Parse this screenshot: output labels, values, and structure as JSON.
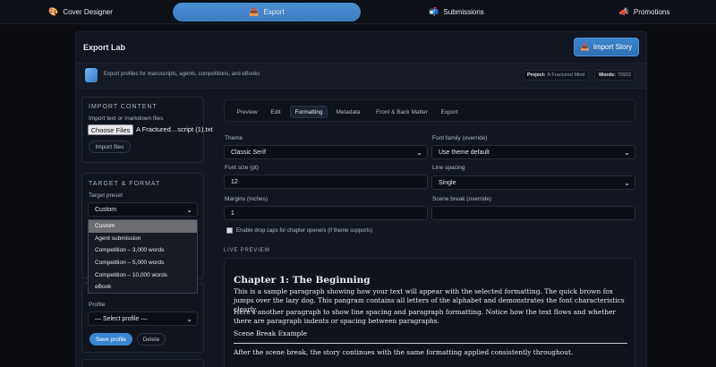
{
  "nav": {
    "tabs": [
      {
        "label": "Cover Designer",
        "icon": "palette-icon"
      },
      {
        "label": "Export",
        "icon": "outbox-icon"
      },
      {
        "label": "Submissions",
        "icon": "mailbox-icon"
      },
      {
        "label": "Promotions",
        "icon": "megaphone-icon"
      }
    ],
    "active": "Export"
  },
  "header": {
    "title": "Export Lab",
    "import_story_label": "Import Story",
    "subtitle": "Export profiles for manuscripts, agents, competitions, and eBooks",
    "project_label": "Project:",
    "project_value": "A Fractured Mind",
    "words_label": "Words:",
    "words_value": "79932"
  },
  "import_content": {
    "heading": "IMPORT CONTENT",
    "hint": "Import text or markdown files",
    "choose_files_label": "Choose Files",
    "file_name": "A Fractured…script (1).txt",
    "import_button": "Import files"
  },
  "target_format": {
    "heading": "TARGET & FORMAT",
    "preset_label": "Target preset",
    "preset_value": "Custom",
    "options": [
      "Custom",
      "Agent submission",
      "Competition – 3,000 words",
      "Competition – 5,000 words",
      "Competition – 10,000 words",
      "eBook"
    ],
    "selected_option": "Custom"
  },
  "profile": {
    "label": "Profile",
    "value": "— Select profile —",
    "save_label": "Save profile",
    "delete_label": "Delete"
  },
  "tabs": [
    "Preview",
    "Edit",
    "Formatting",
    "Metadata",
    "Front & Back Matter",
    "Export"
  ],
  "active_tab": "Formatting",
  "formatting": {
    "theme_label": "Theme",
    "theme_value": "Classic Serif",
    "font_family_label": "Font family (override)",
    "font_family_value": "Use theme default",
    "font_size_label": "Font size (pt)",
    "font_size_value": "12",
    "line_spacing_label": "Line spacing",
    "line_spacing_value": "Single",
    "margins_label": "Margins (inches)",
    "margins_value": "1",
    "scene_break_label": "Scene break (override)",
    "scene_break_value": "",
    "drop_caps_label": "Enable drop caps for chapter openers (if theme supports)",
    "drop_caps_checked": false
  },
  "live_preview": {
    "label": "LIVE PREVIEW",
    "chapter_title": "Chapter 1: The Beginning",
    "para1": "This is a sample paragraph showing how your text will appear with the selected formatting. The quick brown fox jumps over the lazy dog. This pangram contains all letters of the alphabet and demonstrates the font characteristics clearly.",
    "para2": "Here's another paragraph to show line spacing and paragraph formatting. Notice how the text flows and whether there are paragraph indents or spacing between paragraphs.",
    "scene_break_example": "Scene Break Example",
    "para3": "After the scene break, the story continues with the same formatting applied consistently throughout."
  },
  "colors": {
    "accent": "#3a86d3",
    "background": "#0b0d12",
    "panel": "#121620"
  }
}
